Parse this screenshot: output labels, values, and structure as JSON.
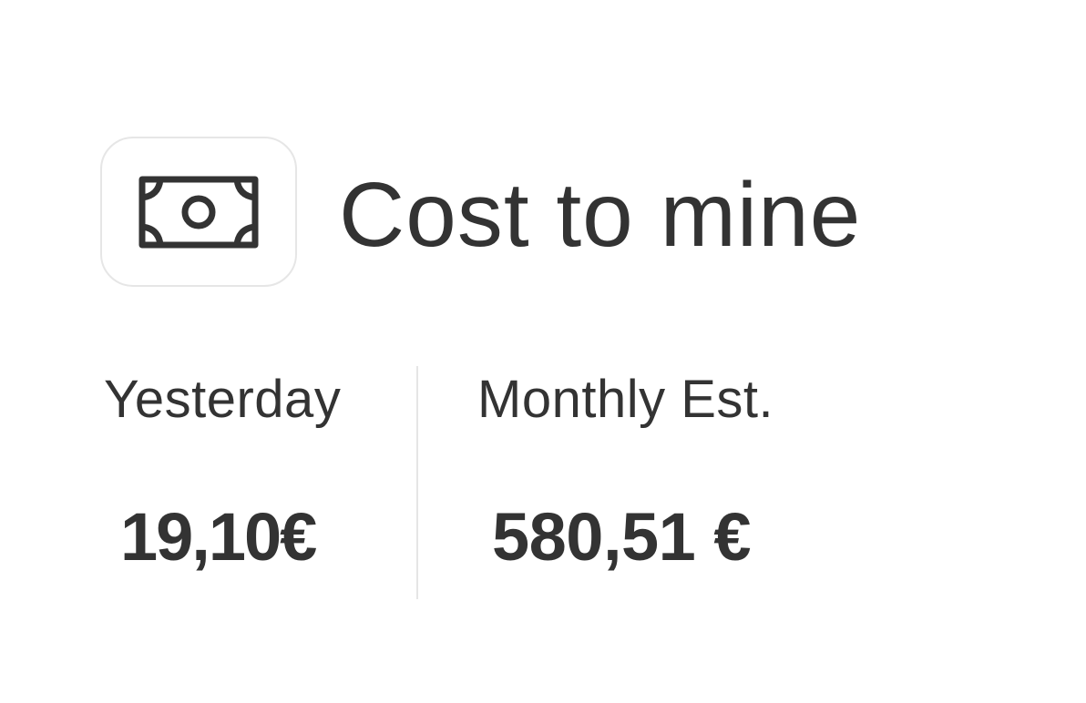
{
  "widget": {
    "title": "Cost to mine",
    "icon": "banknote-icon",
    "stats": {
      "yesterday": {
        "label": "Yesterday",
        "value": "19,10€"
      },
      "monthly": {
        "label": "Monthly Est.",
        "value": "580,51 €"
      }
    }
  },
  "colors": {
    "text": "#333333",
    "border": "#e6e6e6",
    "divider": "#e5e5e5",
    "background": "#ffffff"
  }
}
